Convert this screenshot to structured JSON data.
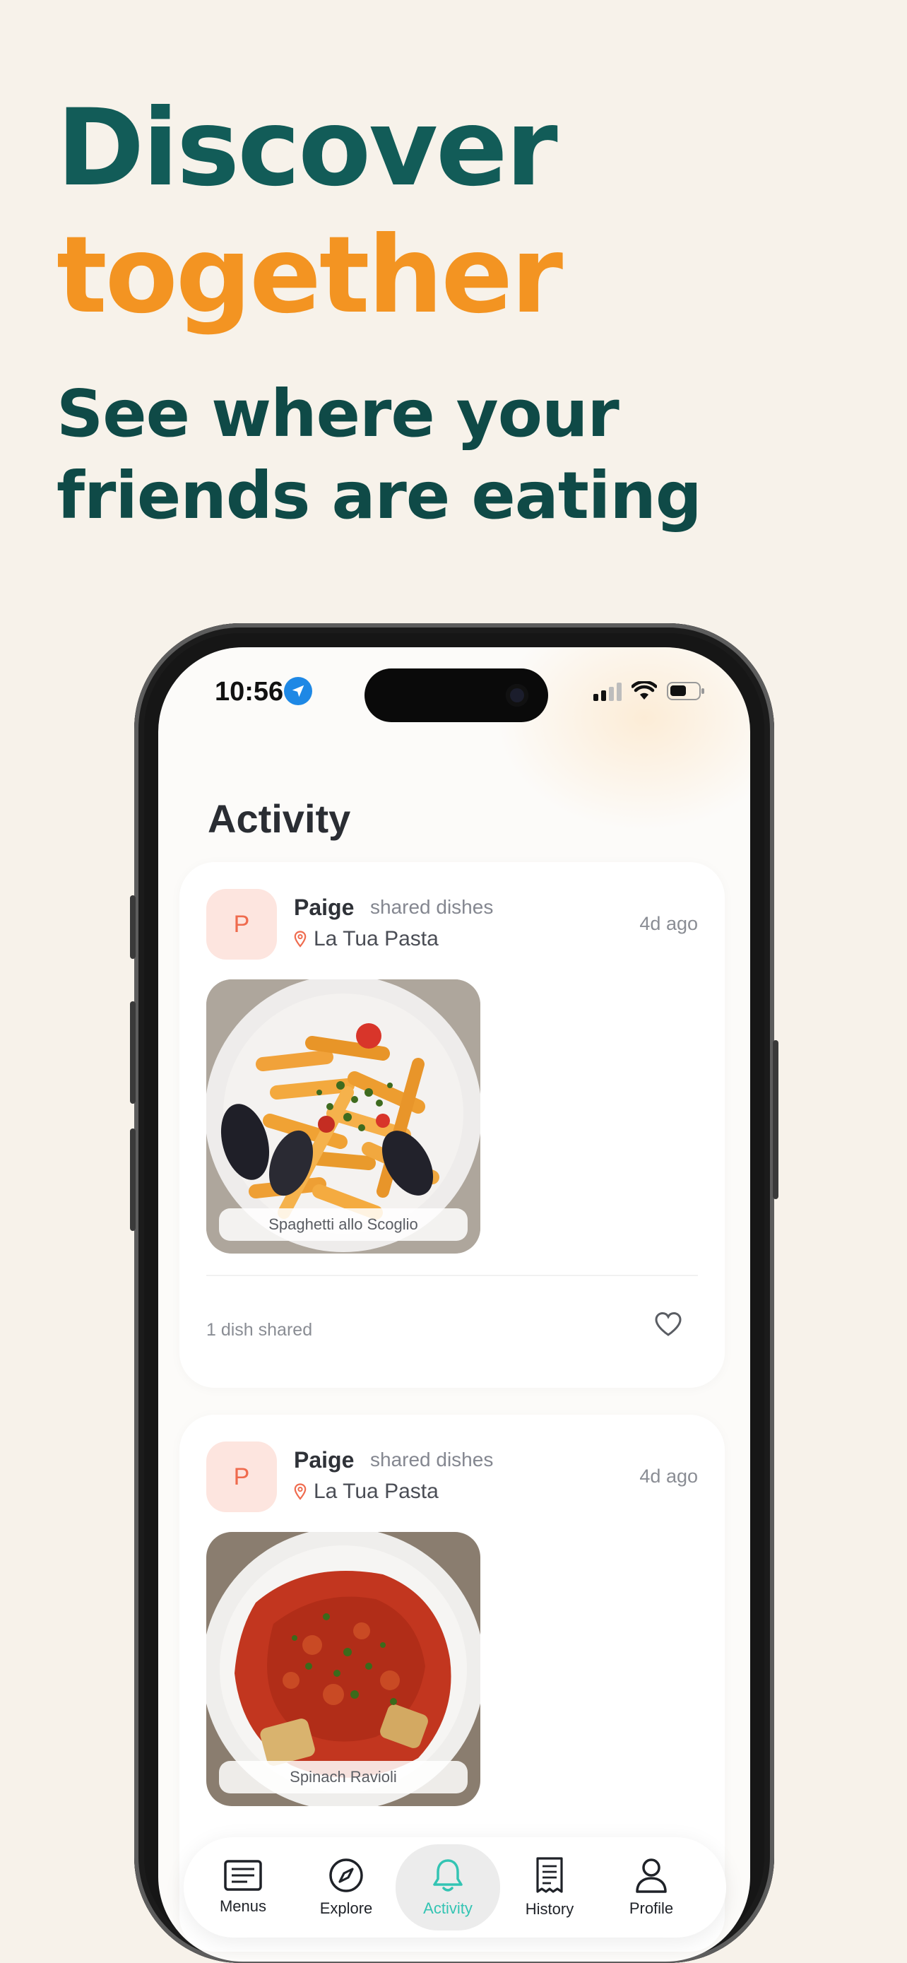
{
  "hero": {
    "line1": "Discover",
    "line2": "together",
    "subtitle_line1": "See where your",
    "subtitle_line2": "friends are eating"
  },
  "colors": {
    "teal": "#125c58",
    "orange": "#f39422",
    "background": "#f7f2ea",
    "accent_active": "#33c4b3",
    "avatar_bg": "#fde5df",
    "avatar_text": "#ef6b4e"
  },
  "status_bar": {
    "time": "10:56",
    "icons": [
      "location-arrow-icon",
      "signal-bars-icon",
      "wifi-icon",
      "battery-icon"
    ]
  },
  "screen": {
    "title": "Activity"
  },
  "feed": [
    {
      "avatar_initial": "P",
      "user": "Paige",
      "action": "shared dishes",
      "restaurant": "La Tua Pasta",
      "time_ago": "4d ago",
      "dish_label": "Spaghetti allo Scoglio",
      "footer": "1 dish shared"
    },
    {
      "avatar_initial": "P",
      "user": "Paige",
      "action": "shared dishes",
      "restaurant": "La Tua Pasta",
      "time_ago": "4d ago",
      "dish_label": "Spinach Ravioli"
    }
  ],
  "tabs": [
    {
      "label": "Menus",
      "icon": "menu-list-icon",
      "active": false
    },
    {
      "label": "Explore",
      "icon": "compass-icon",
      "active": false
    },
    {
      "label": "Activity",
      "icon": "bell-icon",
      "active": true
    },
    {
      "label": "History",
      "icon": "receipt-icon",
      "active": false
    },
    {
      "label": "Profile",
      "icon": "person-icon",
      "active": false
    }
  ]
}
